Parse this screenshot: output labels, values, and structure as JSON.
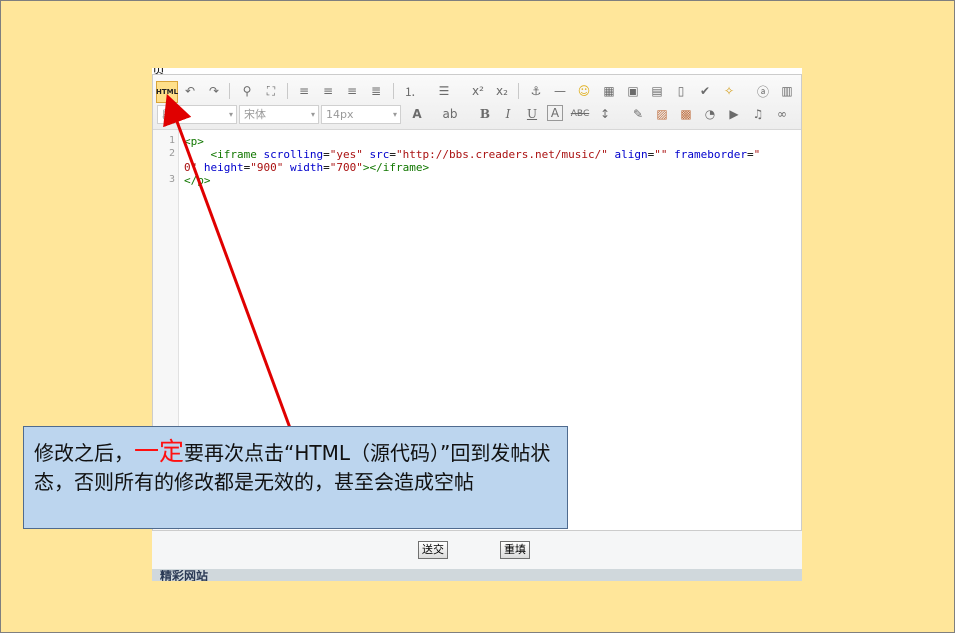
{
  "top_cut_text": "页",
  "toolbar": {
    "html_label": "HTML",
    "paragraph_select": "段落",
    "font_select": "宋体",
    "size_select": "14px"
  },
  "code": {
    "line_numbers": [
      "1",
      "2",
      "",
      "3"
    ],
    "l1": "<p>",
    "l2_indent": "    ",
    "l2_open": "<iframe",
    "a1": "scrolling",
    "v1": "\"yes\"",
    "a2": "src",
    "v2": "\"http://bbs.creaders.net/music/\"",
    "a3": "align",
    "v3": "\"\"",
    "a4": "frameborder",
    "v4a": "\"",
    "v4b": "0\"",
    "a5": "height",
    "v5": "\"900\"",
    "a6": "width",
    "v6": "\"700\"",
    "l2_close": "></iframe>",
    "l3": "</p>"
  },
  "buttons": {
    "submit": "送交",
    "reset": "重填"
  },
  "section_title": "精彩网站",
  "callout": {
    "part1": "修改之后，",
    "emphasis": "一定",
    "part2": "要再次点击“HTML（源代码）”回到发帖状态，否则所有的修改都是无效的，甚至会造成空帖"
  },
  "colors": {
    "slide_bg": "#FFE69A",
    "callout_bg": "#BCD5EE",
    "arrow": "#E00000",
    "emphasis": "#FF1010"
  }
}
